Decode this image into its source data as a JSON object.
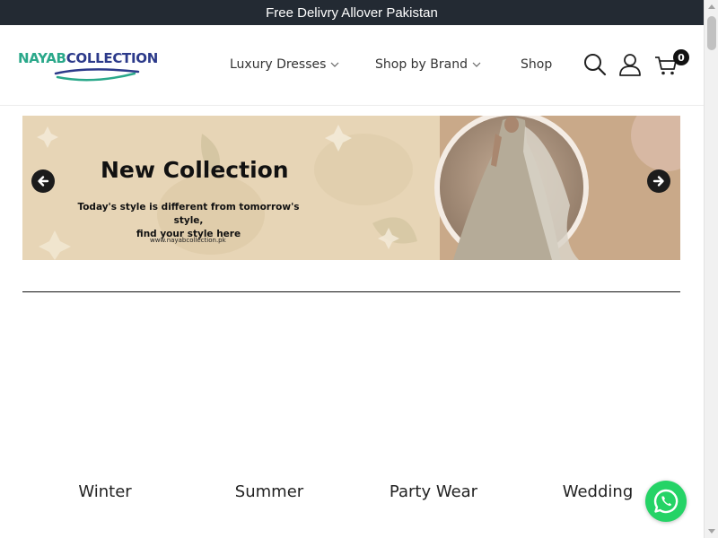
{
  "announcement": "Free Delivry Allover Pakistan",
  "logo": {
    "part1": "NAYAB",
    "part2": "COLLECTION"
  },
  "nav": [
    {
      "label": "Luxury Dresses"
    },
    {
      "label": "Shop by Brand"
    },
    {
      "label": "Shop"
    }
  ],
  "header_icons": [
    "search-icon",
    "user-icon",
    "cart-icon"
  ],
  "cart": {
    "count": "0"
  },
  "banner": {
    "title": "New Collection",
    "subtitle_line1": "Today's style is different from tomorrow's style,",
    "subtitle_line2": "find your style here",
    "url": "www.nayabcollection.pk"
  },
  "categories": [
    {
      "label": "Winter"
    },
    {
      "label": "Summer"
    },
    {
      "label": "Party Wear"
    },
    {
      "label": "Wedding"
    }
  ],
  "colors": {
    "topbar": "#232a33",
    "logo_primary": "#2aa88a",
    "logo_secondary": "#2c3a8a",
    "banner_bg": "#e7d5b6",
    "whatsapp": "#25d366"
  }
}
